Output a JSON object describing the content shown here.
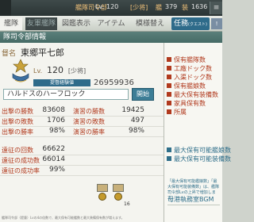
{
  "topbar": {
    "commander_label": "艦隊司令部",
    "lv_label": "Lv.",
    "level": "120",
    "rank": "[少将]",
    "ship_label": "艦",
    "ship_count": "379",
    "item_label": "装",
    "item_count": "1636"
  },
  "tabs": [
    {
      "label": "艦隊"
    },
    {
      "label": "友軍艦隊"
    },
    {
      "label": "図鑑表示"
    },
    {
      "label": "アイテム"
    },
    {
      "label": "模様替え"
    },
    {
      "label": "任務",
      "sub": "(クエスト)"
    }
  ],
  "section_title": "隊司令部情報",
  "profile": {
    "name_label": "督名",
    "name": "東郷平七郎",
    "lv_label": "Lv.",
    "level": "120",
    "rank": "[少将]",
    "exp_label": "提督経験値",
    "exp_value": "26959936",
    "comment": "ハルドスのハーフロック",
    "comment_button": "開始"
  },
  "stats": [
    {
      "l1": "出撃の勝数",
      "v1": "83608",
      "l2": "演習の勝数",
      "v2": "19425"
    },
    {
      "l1": "出撃の敗数",
      "v1": "1706",
      "l2": "演習の敗数",
      "v2": "497"
    },
    {
      "l1": "出撃の勝率",
      "v1": "98%",
      "l2": "演習の勝率",
      "v2": "98%"
    },
    {
      "l1": "遠征の回数",
      "v1": "66622",
      "l2": "",
      "v2": ""
    },
    {
      "l1": "遠征の成功数",
      "v1": "66014",
      "l2": "",
      "v2": ""
    },
    {
      "l1": "遠征の成功率",
      "v1": "99%",
      "l2": "",
      "v2": ""
    }
  ],
  "medal_count": "16",
  "footnote": "艦隊司令部（提督）Lvの4の倍数で、最大保有可能艦数と最大装備保有数が増えます。",
  "right_items_red": [
    "保有艦隊数",
    "工廠ドック数",
    "入渠ドック数",
    "保有艦娘数",
    "最大保有装備数",
    "家具保有数",
    "所属"
  ],
  "right_items_blue": [
    "最大保有可能艦娘数",
    "最大保有可能装備数"
  ],
  "right_note": "「最大保有可能艦娘数」「最大保有可能装備数」は、艦隊司令部Lvの上昇で増加します。",
  "right_bgm": "母港執務室BGM"
}
